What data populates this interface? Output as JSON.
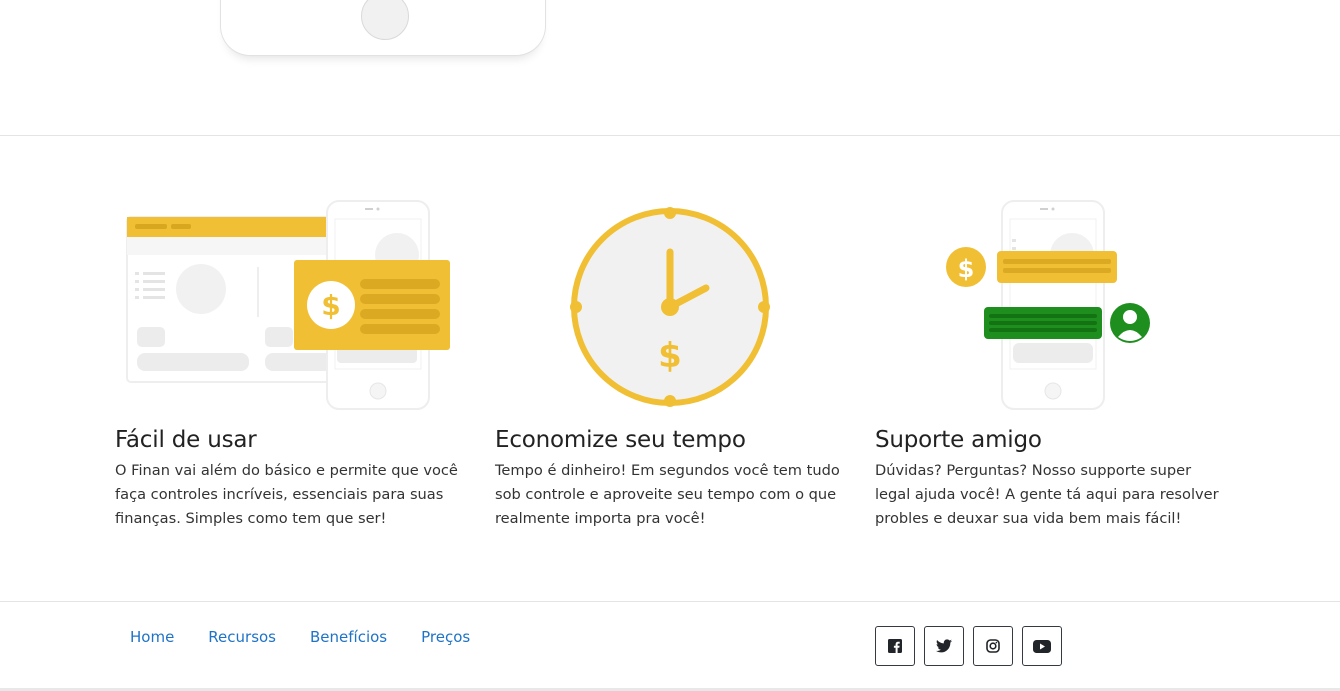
{
  "features": [
    {
      "title": "Fácil de usar",
      "text": "O Finan vai além do básico e permite que você faça controles incríveis, essenciais para suas finanças. Simples como tem que ser!"
    },
    {
      "title": "Economize seu tempo",
      "text": "Tempo é dinheiro! Em segundos você tem tudo sob controle e aproveite seu tempo com o que realmente importa pra você!"
    },
    {
      "title": "Suporte amigo",
      "text": "Dúvidas? Perguntas? Nosso supporte super legal ajuda você! A gente tá aqui para resolver probles e deuxar sua vida bem mais fácil!"
    }
  ],
  "footer": {
    "nav": [
      "Home",
      "Recursos",
      "Benefícios",
      "Preços"
    ],
    "social": [
      {
        "icon": "facebook-icon"
      },
      {
        "icon": "twitter-icon"
      },
      {
        "icon": "instagram-icon"
      },
      {
        "icon": "youtube-icon"
      }
    ]
  },
  "colors": {
    "accent_yellow": "#f0bf34",
    "accent_green": "#1e8f1e",
    "link_blue": "#1e73c7"
  }
}
